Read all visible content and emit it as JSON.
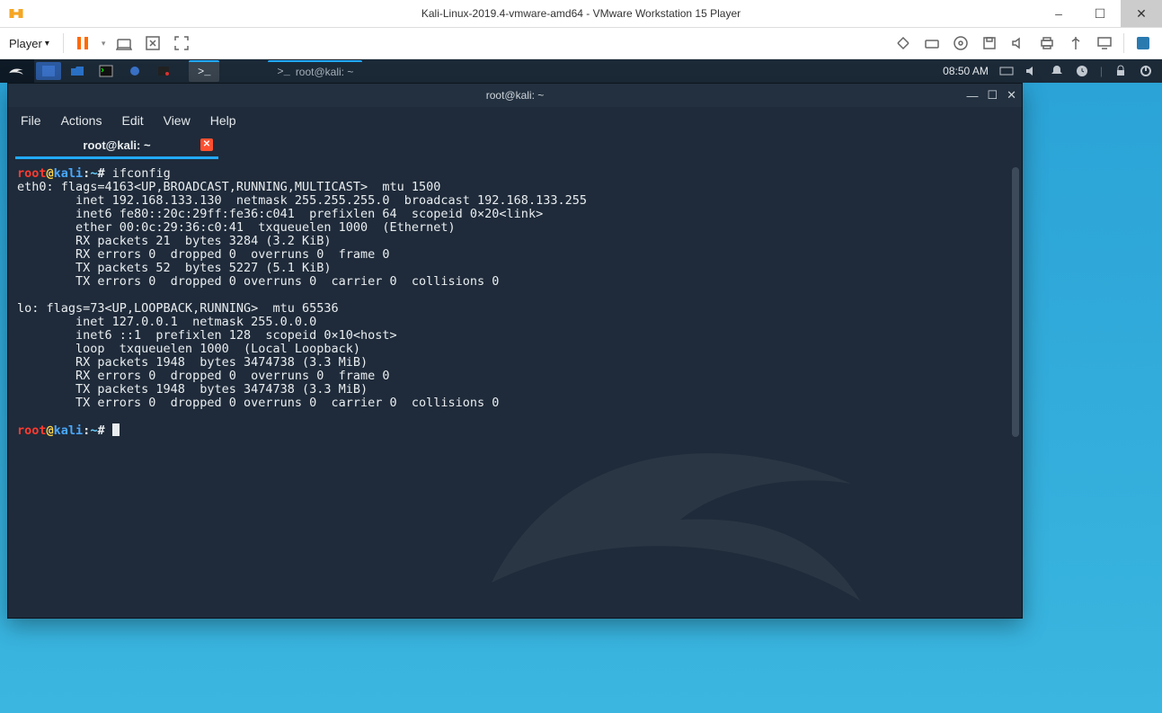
{
  "host_window": {
    "title": "Kali-Linux-2019.4-vmware-amd64 - VMware Workstation 15 Player",
    "controls": {
      "min": "–",
      "max": "☐",
      "close": "✕"
    }
  },
  "vm_toolbar": {
    "player_label": "Player",
    "dropdown_glyph": "▾"
  },
  "kali_panel": {
    "task_active": "root@kali: ~",
    "task_inactive": "root@kali: ~",
    "clock": "08:50 AM"
  },
  "terminal": {
    "window_title": "root@kali: ~",
    "menu": [
      "File",
      "Actions",
      "Edit",
      "View",
      "Help"
    ],
    "tab_label": "root@kali: ~",
    "prompt": {
      "user": "root",
      "at": "@",
      "host": "kali",
      "colon": ":",
      "path": "~",
      "sym": "#"
    },
    "command1": "ifconfig",
    "output": "eth0: flags=4163<UP,BROADCAST,RUNNING,MULTICAST>  mtu 1500\n        inet 192.168.133.130  netmask 255.255.255.0  broadcast 192.168.133.255\n        inet6 fe80::20c:29ff:fe36:c041  prefixlen 64  scopeid 0×20<link>\n        ether 00:0c:29:36:c0:41  txqueuelen 1000  (Ethernet)\n        RX packets 21  bytes 3284 (3.2 KiB)\n        RX errors 0  dropped 0  overruns 0  frame 0\n        TX packets 52  bytes 5227 (5.1 KiB)\n        TX errors 0  dropped 0 overruns 0  carrier 0  collisions 0\n\nlo: flags=73<UP,LOOPBACK,RUNNING>  mtu 65536\n        inet 127.0.0.1  netmask 255.0.0.0\n        inet6 ::1  prefixlen 128  scopeid 0×10<host>\n        loop  txqueuelen 1000  (Local Loopback)\n        RX packets 1948  bytes 3474738 (3.3 MiB)\n        RX errors 0  dropped 0  overruns 0  frame 0\n        TX packets 1948  bytes 3474738 (3.3 MiB)\n        TX errors 0  dropped 0 overruns 0  carrier 0  collisions 0"
  }
}
